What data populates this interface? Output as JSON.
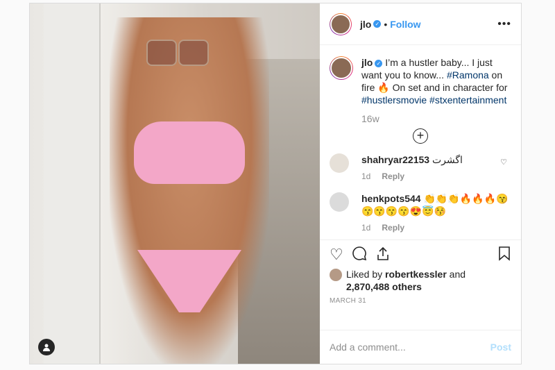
{
  "header": {
    "username": "jlo",
    "follow_label": "Follow",
    "more_label": "•••"
  },
  "caption": {
    "username": "jlo",
    "text_1": " I’m a hustler baby... I just want you to know... ",
    "tag_1": "#Ramona",
    "text_2": " on fire 🔥 On set and in character for ",
    "tag_2": "#hustlersmovie",
    "tag_3": "#stxentertainment",
    "time": "16w"
  },
  "load_more_label": "+",
  "comments": [
    {
      "username": "shahryar22153",
      "text": " اگشرت",
      "time": "1d",
      "reply": "Reply"
    },
    {
      "username": "henkpots544",
      "text": " 👏👏👏🔥🔥🔥😙 😙😙😙😙😍😇😚",
      "time": "1d",
      "reply": "Reply"
    }
  ],
  "likes": {
    "prefix": "Liked by ",
    "user": "robertkessler",
    "middle": " and",
    "count": "2,870,488 others"
  },
  "date": "MARCH 31",
  "add_comment": {
    "placeholder": "Add a comment...",
    "post_label": "Post"
  },
  "icons": [
    "heart-icon",
    "comment-icon",
    "share-icon",
    "bookmark-icon"
  ],
  "colors": {
    "accent": "#3897f0",
    "post_disabled": "#b2dffc",
    "muted": "#8e8e8e"
  }
}
